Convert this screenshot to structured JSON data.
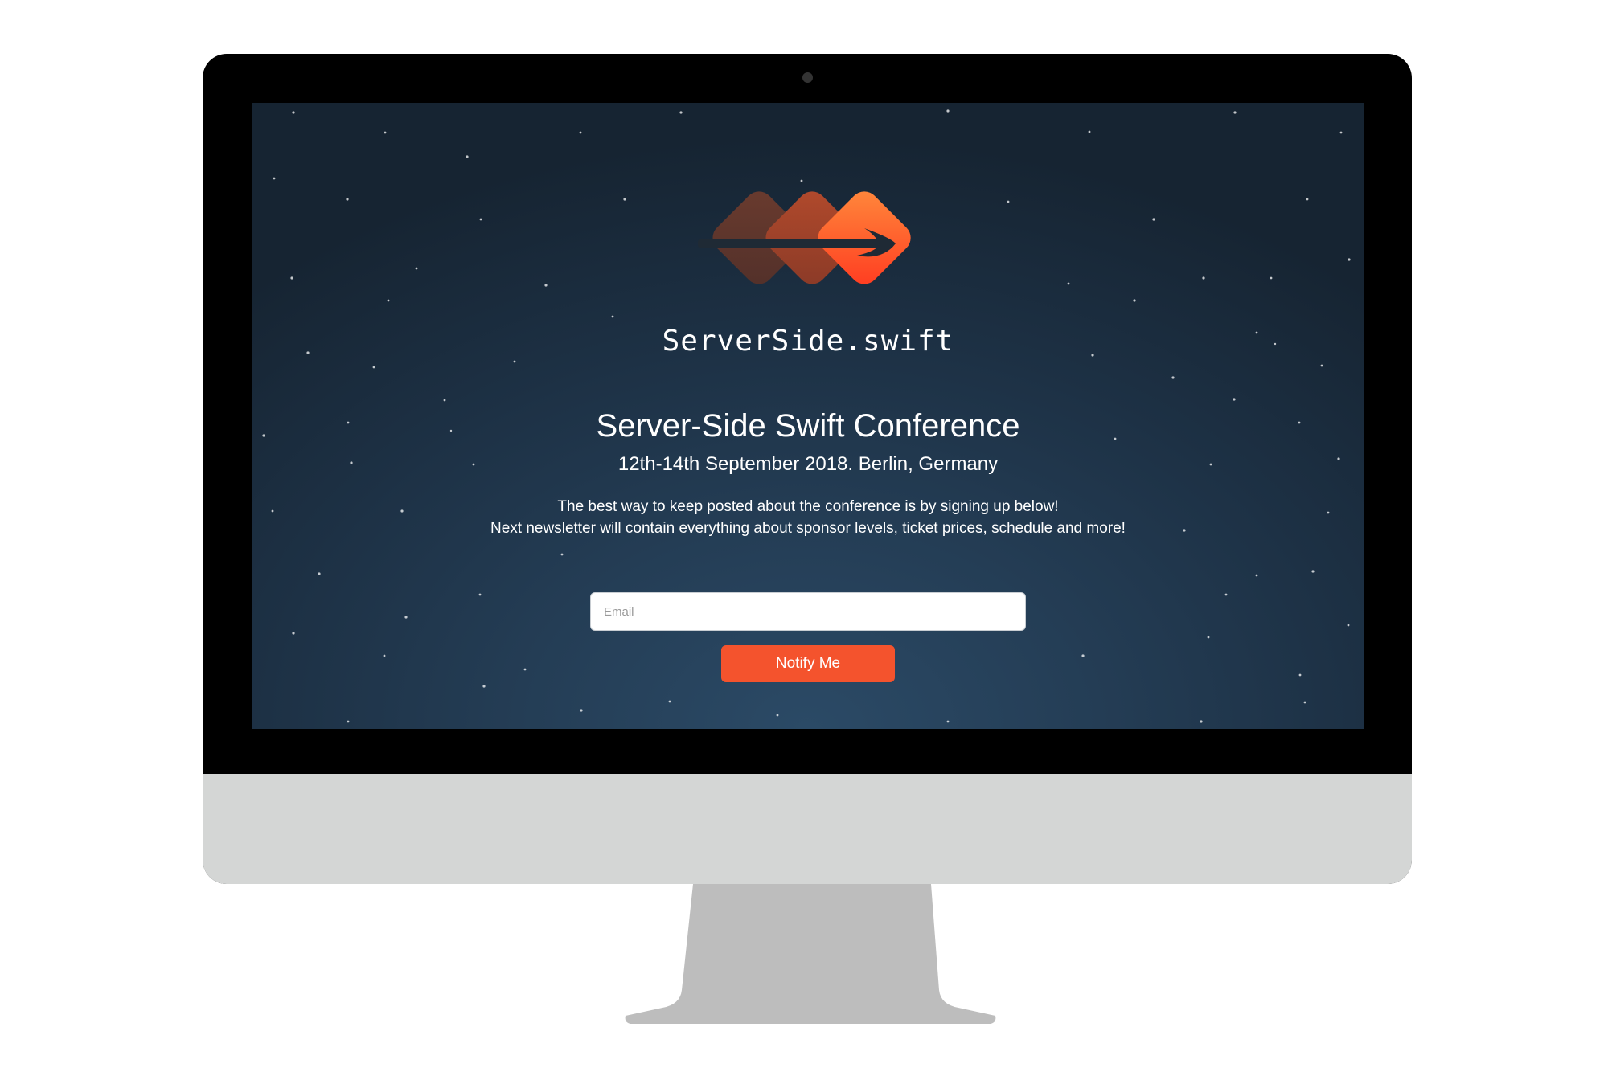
{
  "site": {
    "wordmark": "ServerSide.swift"
  },
  "hero": {
    "title": "Server-Side Swift Conference",
    "subtitle": "12th-14th September 2018. Berlin, Germany",
    "description_line1": "The best way to keep posted about the conference is by signing up below!",
    "description_line2": "Next newsletter will contain everything about sponsor levels, ticket prices, schedule and more!"
  },
  "signup": {
    "email_placeholder": "Email",
    "email_value": "",
    "button_label": "Notify Me"
  },
  "colors": {
    "accent": "#f4532d",
    "background": "#1d3145"
  }
}
